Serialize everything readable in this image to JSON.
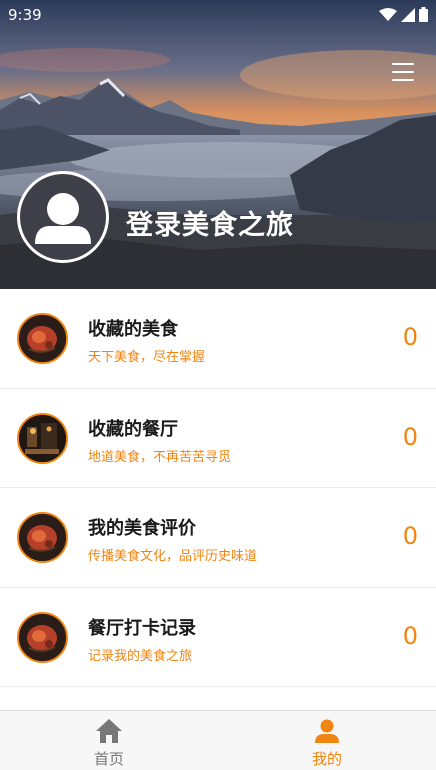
{
  "status": {
    "time": "9:39"
  },
  "header": {
    "login_text": "登录美食之旅"
  },
  "list": [
    {
      "title": "收藏的美食",
      "subtitle": "天下美食，尽在掌握",
      "count": "0",
      "icon": "food-dish-icon"
    },
    {
      "title": "收藏的餐厅",
      "subtitle": "地道美食，不再苦苦寻觅",
      "count": "0",
      "icon": "restaurant-icon"
    },
    {
      "title": "我的美食评价",
      "subtitle": "传播美食文化，品评历史味道",
      "count": "0",
      "icon": "food-dish-icon"
    },
    {
      "title": "餐厅打卡记录",
      "subtitle": "记录我的美食之旅",
      "count": "0",
      "icon": "food-dish-icon"
    }
  ],
  "tabbar": {
    "tabs": [
      {
        "label": "首页",
        "icon": "home-icon",
        "active": false
      },
      {
        "label": "我的",
        "icon": "person-icon",
        "active": true
      }
    ]
  },
  "colors": {
    "accent": "#f08512",
    "inactive": "#777777"
  }
}
